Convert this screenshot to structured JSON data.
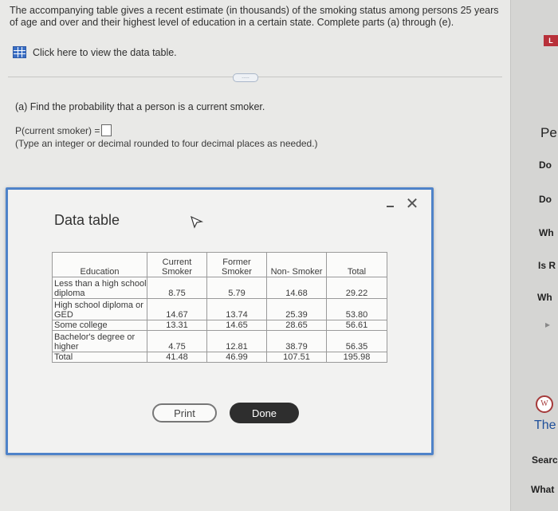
{
  "question": {
    "intro_text": "The accompanying table gives a recent estimate (in thousands) of the smoking status among persons 25 years of age and over and their highest level of education in a certain state. Complete parts (a) through (e).",
    "data_link": "Click here to view the data table.",
    "collapse_label": "....."
  },
  "part_a": {
    "prompt": "(a) Find the probability that a person is a current smoker.",
    "answer_label": "P(current smoker) =",
    "answer_value": "",
    "hint": "(Type an integer or decimal rounded to four decimal places as needed.)"
  },
  "modal": {
    "title": "Data table",
    "minimize_label": "minimize",
    "close_label": "✕",
    "table": {
      "headers": [
        "Education",
        "Current Smoker",
        "Former Smoker",
        "Non- Smoker",
        "Total"
      ],
      "rows": [
        [
          "Less than a high school diploma",
          "8.75",
          "5.79",
          "14.68",
          "29.22"
        ],
        [
          "High school diploma or GED",
          "14.67",
          "13.74",
          "25.39",
          "53.80"
        ],
        [
          "Some college",
          "13.31",
          "14.65",
          "28.65",
          "56.61"
        ],
        [
          "Bachelor's degree or higher",
          "4.75",
          "12.81",
          "38.79",
          "56.35"
        ],
        [
          "Total",
          "41.48",
          "46.99",
          "107.51",
          "195.98"
        ]
      ]
    },
    "print_label": "Print",
    "done_label": "Done"
  },
  "sidebar": {
    "logo_text": "L",
    "items": [
      "Pe",
      "Do",
      "Do",
      "Wh",
      "Is R",
      "Wh",
      "▸",
      "The",
      "Searc",
      "What"
    ]
  },
  "colors": {
    "modal_border": "#4f83c9",
    "done_button": "#2e2e2e",
    "grid_icon": "#3b6fc4"
  }
}
